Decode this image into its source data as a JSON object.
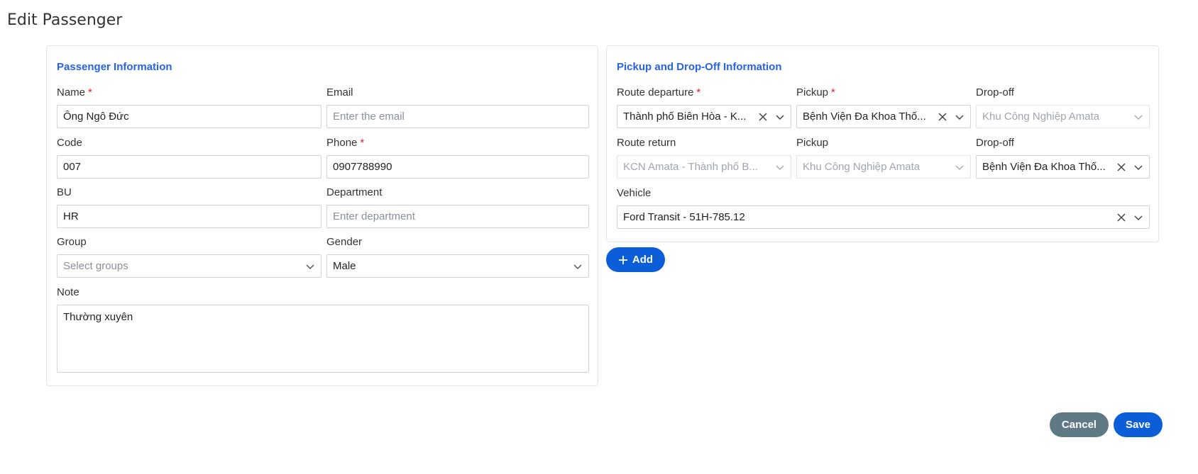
{
  "page": {
    "title": "Edit Passenger"
  },
  "passenger": {
    "section_title": "Passenger Information",
    "name": {
      "label": "Name",
      "value": "Ông Ngô Đức",
      "required": "*"
    },
    "email": {
      "label": "Email",
      "placeholder": "Enter the email"
    },
    "code": {
      "label": "Code",
      "value": "007"
    },
    "phone": {
      "label": "Phone",
      "value": "0907788990",
      "required": "*"
    },
    "bu": {
      "label": "BU",
      "value": "HR"
    },
    "department": {
      "label": "Department",
      "placeholder": "Enter department"
    },
    "group": {
      "label": "Group",
      "placeholder": "Select groups"
    },
    "gender": {
      "label": "Gender",
      "value": "Male"
    },
    "note": {
      "label": "Note",
      "value": "Thường xuyên"
    }
  },
  "pickup": {
    "section_title": "Pickup and Drop-Off Information",
    "route_departure": {
      "label": "Route departure",
      "required": "*",
      "value": "Thành phố Biên Hòa - K..."
    },
    "pickup_departure": {
      "label": "Pickup",
      "required": "*",
      "value": "Bệnh Viện Đa Khoa Thố..."
    },
    "dropoff_departure": {
      "label": "Drop-off",
      "value": "Khu Công Nghiệp Amata"
    },
    "route_return": {
      "label": "Route return",
      "value": "KCN Amata - Thành phố B..."
    },
    "pickup_return": {
      "label": "Pickup",
      "value": "Khu Công Nghiệp Amata"
    },
    "dropoff_return": {
      "label": "Drop-off",
      "value": "Bệnh Viện Đa Khoa Thố..."
    },
    "vehicle": {
      "label": "Vehicle",
      "value": "Ford Transit - 51H-785.12"
    }
  },
  "actions": {
    "add": "Add",
    "cancel": "Cancel",
    "save": "Save"
  },
  "colors": {
    "accent": "#0b5ed7",
    "section_title": "#2563eb",
    "required": "#e11d2a",
    "cancel": "#5f7a85"
  }
}
